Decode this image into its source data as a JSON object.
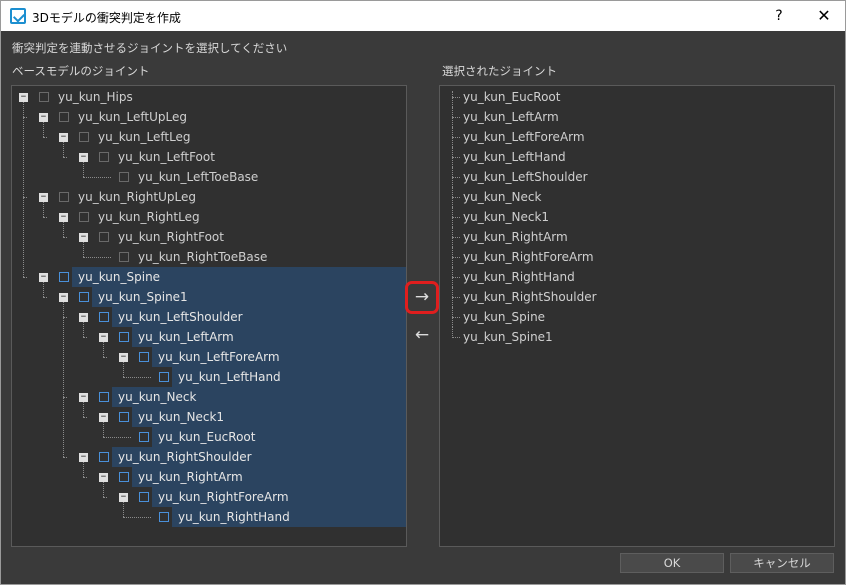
{
  "window": {
    "title": "3Dモデルの衝突判定を作成",
    "help_label": "?",
    "close_label": "✕"
  },
  "instruction": "衝突判定を連動させるジョイントを選択してください",
  "left_panel": {
    "label": "ベースモデルのジョイント",
    "tree": [
      {
        "label": "yu_kun_Hips",
        "depth": 0,
        "selected": false,
        "expanded": true
      },
      {
        "label": "yu_kun_LeftUpLeg",
        "depth": 1,
        "selected": false,
        "expanded": true
      },
      {
        "label": "yu_kun_LeftLeg",
        "depth": 2,
        "selected": false,
        "expanded": true
      },
      {
        "label": "yu_kun_LeftFoot",
        "depth": 3,
        "selected": false,
        "expanded": true
      },
      {
        "label": "yu_kun_LeftToeBase",
        "depth": 4,
        "selected": false,
        "expanded": false
      },
      {
        "label": "yu_kun_RightUpLeg",
        "depth": 1,
        "selected": false,
        "expanded": true
      },
      {
        "label": "yu_kun_RightLeg",
        "depth": 2,
        "selected": false,
        "expanded": true
      },
      {
        "label": "yu_kun_RightFoot",
        "depth": 3,
        "selected": false,
        "expanded": true
      },
      {
        "label": "yu_kun_RightToeBase",
        "depth": 4,
        "selected": false,
        "expanded": false
      },
      {
        "label": "yu_kun_Spine",
        "depth": 1,
        "selected": true,
        "expanded": true
      },
      {
        "label": "yu_kun_Spine1",
        "depth": 2,
        "selected": true,
        "expanded": true
      },
      {
        "label": "yu_kun_LeftShoulder",
        "depth": 3,
        "selected": true,
        "expanded": true
      },
      {
        "label": "yu_kun_LeftArm",
        "depth": 4,
        "selected": true,
        "expanded": true
      },
      {
        "label": "yu_kun_LeftForeArm",
        "depth": 5,
        "selected": true,
        "expanded": true
      },
      {
        "label": "yu_kun_LeftHand",
        "depth": 6,
        "selected": true,
        "expanded": false
      },
      {
        "label": "yu_kun_Neck",
        "depth": 3,
        "selected": true,
        "expanded": true
      },
      {
        "label": "yu_kun_Neck1",
        "depth": 4,
        "selected": true,
        "expanded": true
      },
      {
        "label": "yu_kun_EucRoot",
        "depth": 5,
        "selected": true,
        "expanded": false
      },
      {
        "label": "yu_kun_RightShoulder",
        "depth": 3,
        "selected": true,
        "expanded": true
      },
      {
        "label": "yu_kun_RightArm",
        "depth": 4,
        "selected": true,
        "expanded": true
      },
      {
        "label": "yu_kun_RightForeArm",
        "depth": 5,
        "selected": true,
        "expanded": true
      },
      {
        "label": "yu_kun_RightHand",
        "depth": 6,
        "selected": true,
        "expanded": false
      }
    ]
  },
  "right_panel": {
    "label": "選択されたジョイント",
    "items": [
      "yu_kun_EucRoot",
      "yu_kun_LeftArm",
      "yu_kun_LeftForeArm",
      "yu_kun_LeftHand",
      "yu_kun_LeftShoulder",
      "yu_kun_Neck",
      "yu_kun_Neck1",
      "yu_kun_RightArm",
      "yu_kun_RightForeArm",
      "yu_kun_RightHand",
      "yu_kun_RightShoulder",
      "yu_kun_Spine",
      "yu_kun_Spine1"
    ]
  },
  "transfer": {
    "move_right_icon": "arrow-right-icon",
    "move_right_label": "→",
    "move_left_icon": "arrow-left-icon",
    "move_left_label": "←"
  },
  "buttons": {
    "ok": "OK",
    "cancel": "キャンセル"
  },
  "colors": {
    "selection": "#2b4460",
    "highlight_border": "#e01e1e",
    "app_icon": "#1c8fd0"
  }
}
